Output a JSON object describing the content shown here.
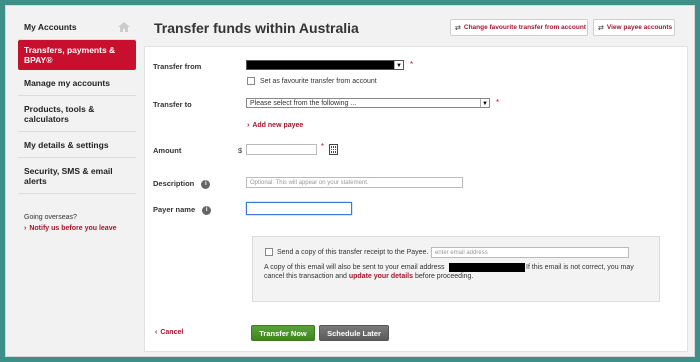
{
  "sidebar": {
    "items": [
      {
        "label": "My Accounts"
      },
      {
        "label": "Transfers, payments & BPAY®"
      },
      {
        "label": "Manage my accounts"
      },
      {
        "label": "Products, tools & calculators"
      },
      {
        "label": "My details & settings"
      },
      {
        "label": "Security, SMS & email alerts"
      }
    ],
    "overseas_text": "Going overseas?",
    "overseas_link": "Notify us before you leave"
  },
  "header": {
    "title": "Transfer funds within Australia",
    "change_fav_label": "Change favourite transfer from account",
    "view_payee_label": "View payee accounts"
  },
  "form": {
    "transfer_from_label": "Transfer from",
    "favourite_label": "Set as favourite transfer from account",
    "transfer_to_label": "Transfer to",
    "transfer_to_value": "Please select from the following ...",
    "add_payee_label": "Add new payee",
    "amount_label": "Amount",
    "currency_symbol": "$",
    "description_label": "Description",
    "description_placeholder": "Optional: This will appear on your statement.",
    "payer_label": "Payer name",
    "receipt_label": "Send a copy of this transfer receipt to the Payee.",
    "email_placeholder": "enter email address",
    "copy_text_1": "A copy of this email will also be sent to your email address",
    "copy_text_2": "If this email is not correct, you may",
    "copy_text_3": "cancel this transaction and",
    "update_link": "update your details",
    "copy_text_4": "before proceeding.",
    "required_mark": "*"
  },
  "actions": {
    "cancel_label": "Cancel",
    "transfer_now_label": "Transfer Now",
    "schedule_later_label": "Schedule Later"
  }
}
